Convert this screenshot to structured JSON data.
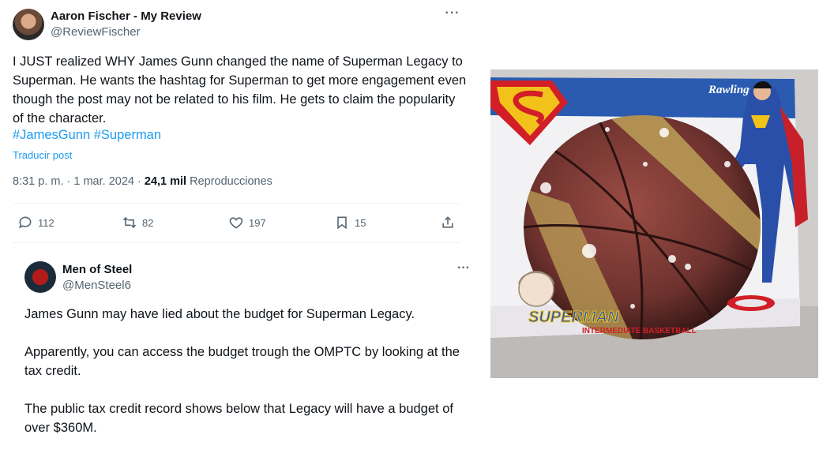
{
  "tweet": {
    "author_name": "Aaron Fischer - My Review",
    "author_handle": "@ReviewFischer",
    "more_label": "···",
    "text": "I JUST realized WHY James Gunn changed the name of Superman Legacy to Superman. He wants the hashtag for Superman to get more engagement even though the post may not be related to his film. He gets to claim the popularity of the character.",
    "hashtags": [
      "#JamesGunn",
      "#Superman"
    ],
    "translate_label": "Traducir post",
    "time": "8:31 p. m.",
    "separator": "·",
    "date": "1 mar. 2024",
    "views_count": "24,1 mil",
    "views_label": "Reproducciones",
    "actions": {
      "replies": "112",
      "retweets": "82",
      "likes": "197",
      "bookmarks": "15"
    }
  },
  "reply": {
    "author_name": "Men of Steel",
    "author_handle": "@MenSteel6",
    "more_label": "···",
    "paragraphs": [
      "James Gunn may have lied about the budget for Superman Legacy.",
      "Apparently, you can access the budget trough the OMPTC by looking at the tax credit.",
      "The public tax credit record shows below that Legacy will have a budget of over $360M."
    ]
  },
  "photo": {
    "brand_text": "Rawlings",
    "box_text": "SUPERMAN",
    "ball_text": "INTERMEDIATE BASKETBALL",
    "colors": {
      "box_blue": "#2a5bb0",
      "ball": "#7a3a35",
      "stripe": "#b89a55",
      "logo_red": "#d21f27",
      "logo_yellow": "#f3c21a"
    }
  },
  "colors": {
    "link": "#1d9bf0",
    "secondary_text": "#536471",
    "primary_text": "#0f1419",
    "divider": "#eff3f4"
  }
}
